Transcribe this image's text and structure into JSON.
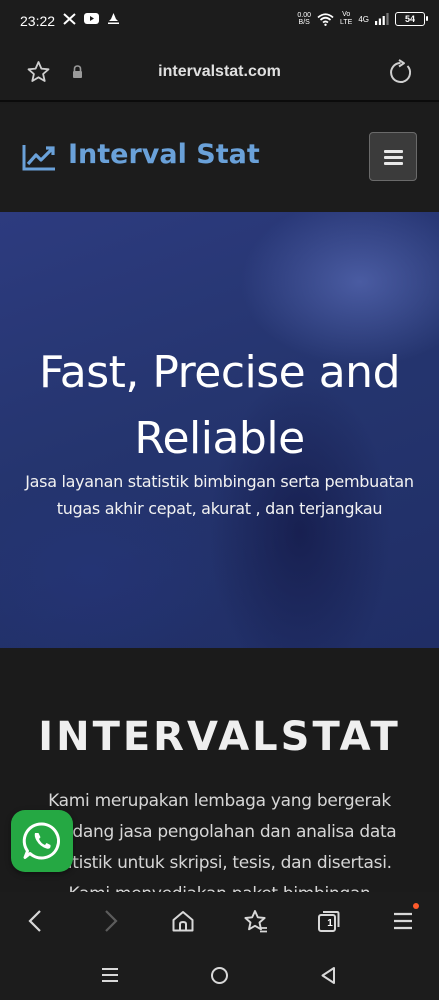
{
  "status_bar": {
    "time": "23:22",
    "speed_value": "0.00",
    "speed_unit": "B/S",
    "volte_top": "Vo",
    "volte_bottom": "LTE",
    "network": "4G",
    "battery": "54"
  },
  "address_bar": {
    "url": "intervalstat.com"
  },
  "site_nav": {
    "brand": "Interval Stat",
    "brand_color": "#6aa1d9"
  },
  "hero": {
    "title_line1": "Fast, Precise and",
    "title_line2": "Reliable",
    "subtitle_line1": "Jasa layanan statistik bimbingan serta pembuatan",
    "subtitle_line2": "tugas akhir cepat, akurat , dan terjangkau"
  },
  "about": {
    "title": "INTERVALSTAT",
    "line1": "Kami merupakan lembaga yang bergerak",
    "line2": "dibidang jasa pengolahan dan analisa data",
    "line3": "statistik untuk skripsi, tesis, dan disertasi.",
    "line4": "Kami menyediakan paket bimbingan"
  },
  "browser_toolbar": {
    "tabs_count": "1"
  },
  "icons": {
    "status_left": [
      "x-icon",
      "youtube-icon",
      "notification-icon"
    ],
    "status_right": [
      "wifi-icon",
      "signal-icon"
    ],
    "address": [
      "star-icon",
      "lock-icon",
      "reload-icon"
    ],
    "toolbar": [
      "back-icon",
      "forward-icon",
      "home-icon",
      "bookmarks-icon",
      "tabs-icon",
      "menu-icon"
    ],
    "system": [
      "recents-icon",
      "home-circle-icon",
      "back-triangle-icon"
    ],
    "floating": "whatsapp-icon"
  }
}
